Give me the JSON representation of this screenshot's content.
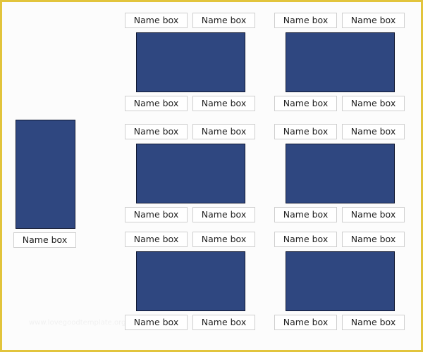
{
  "watermark": "www.lovegoodtemplate.org",
  "colors": {
    "frame": "#e2c43c",
    "photo_fill": "#2f4780",
    "background": "#fcfcfc"
  },
  "single": {
    "photo_label": "photo-placeholder",
    "name": "Name box"
  },
  "groups": [
    {
      "top_names": [
        "Name box",
        "Name box"
      ],
      "bottom_names": [
        "Name box",
        "Name box"
      ]
    },
    {
      "top_names": [
        "Name box",
        "Name box"
      ],
      "bottom_names": [
        "Name box",
        "Name box"
      ]
    },
    {
      "top_names": [
        "Name box",
        "Name box"
      ],
      "bottom_names": [
        "Name box",
        "Name box"
      ]
    },
    {
      "top_names": [
        "Name box",
        "Name box"
      ],
      "bottom_names": [
        "Name box",
        "Name box"
      ]
    },
    {
      "top_names": [
        "Name box",
        "Name box"
      ],
      "bottom_names": [
        "Name box",
        "Name box"
      ]
    },
    {
      "top_names": [
        "Name box",
        "Name box"
      ],
      "bottom_names": [
        "Name box",
        "Name box"
      ]
    }
  ]
}
